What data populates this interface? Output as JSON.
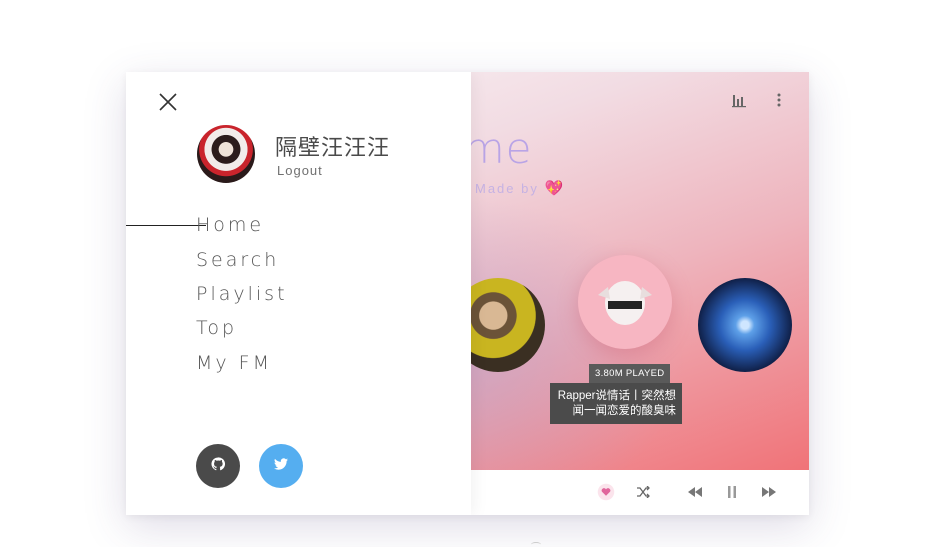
{
  "main": {
    "title": "ome",
    "made_by": "Made by",
    "made_by_icon": "heart-emoji",
    "top_icons": [
      "equalizer-icon",
      "more-vertical-icon"
    ],
    "albums": [
      {
        "position": "left",
        "icon": "album-cover-man"
      },
      {
        "position": "center",
        "icon": "album-cover-meme-cat"
      },
      {
        "position": "right",
        "icon": "album-cover-galaxy"
      }
    ],
    "featured": {
      "played": "3.80M PLAYED",
      "title": "Rapper说情话丨突然想闻一闻恋爱的酸臭味"
    }
  },
  "player": {
    "controls": [
      "like-icon",
      "shuffle-icon",
      "previous-icon",
      "pause-icon",
      "next-icon"
    ],
    "accent_color": "#e0669c"
  },
  "drawer": {
    "close_icon": "close-icon",
    "user": {
      "name": "隔壁汪汪汪",
      "logout": "Logout"
    },
    "nav": [
      "Home",
      "Search",
      "Playlist",
      "Top",
      "My FM"
    ],
    "active_nav": "Home",
    "social": [
      {
        "name": "github",
        "icon": "github-icon",
        "color": "#4a4a4a"
      },
      {
        "name": "twitter",
        "icon": "twitter-icon",
        "color": "#55aef0"
      }
    ]
  }
}
